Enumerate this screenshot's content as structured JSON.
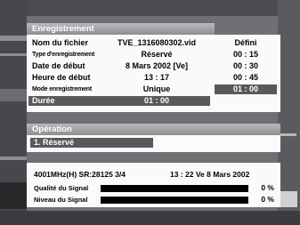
{
  "recording": {
    "title": "Enregistrement",
    "fields": [
      {
        "label": "Nom du fichier",
        "value": "TVE_1316080302.vid"
      },
      {
        "label": "Type d'enregistrement",
        "value": "Réservé"
      },
      {
        "label": "Date de début",
        "value": "8 Mars 2002 [Ve]"
      },
      {
        "label": "Heure de début",
        "value": "13 : 17"
      },
      {
        "label": "Mode enregistrement",
        "value": "Unique"
      },
      {
        "label": "Durée",
        "value": "01 : 00"
      }
    ]
  },
  "duration_options": {
    "items": [
      "Défini",
      "00 : 15",
      "00 : 30",
      "00 : 45",
      "01 : 00"
    ],
    "selected": "01 : 00"
  },
  "operation": {
    "title": "Opération",
    "items": [
      "1. Réservé"
    ]
  },
  "status": {
    "frequency": "4001MHz(H) SR:28125 3/4",
    "datetime": "13 : 22  Ve  8 Mars 2002",
    "signal_quality_label": "Qualité du Signal",
    "signal_quality_pct": "0 %",
    "signal_quality_value": 0,
    "signal_level_label": "Niveau du Signal",
    "signal_level_pct": "0 %",
    "signal_level_value": 0
  },
  "colors": {
    "panel_bg": "#fafafa",
    "header_bg": "#a4a4a6",
    "selection_bg": "#58595c",
    "meter_bg": "#000000"
  }
}
